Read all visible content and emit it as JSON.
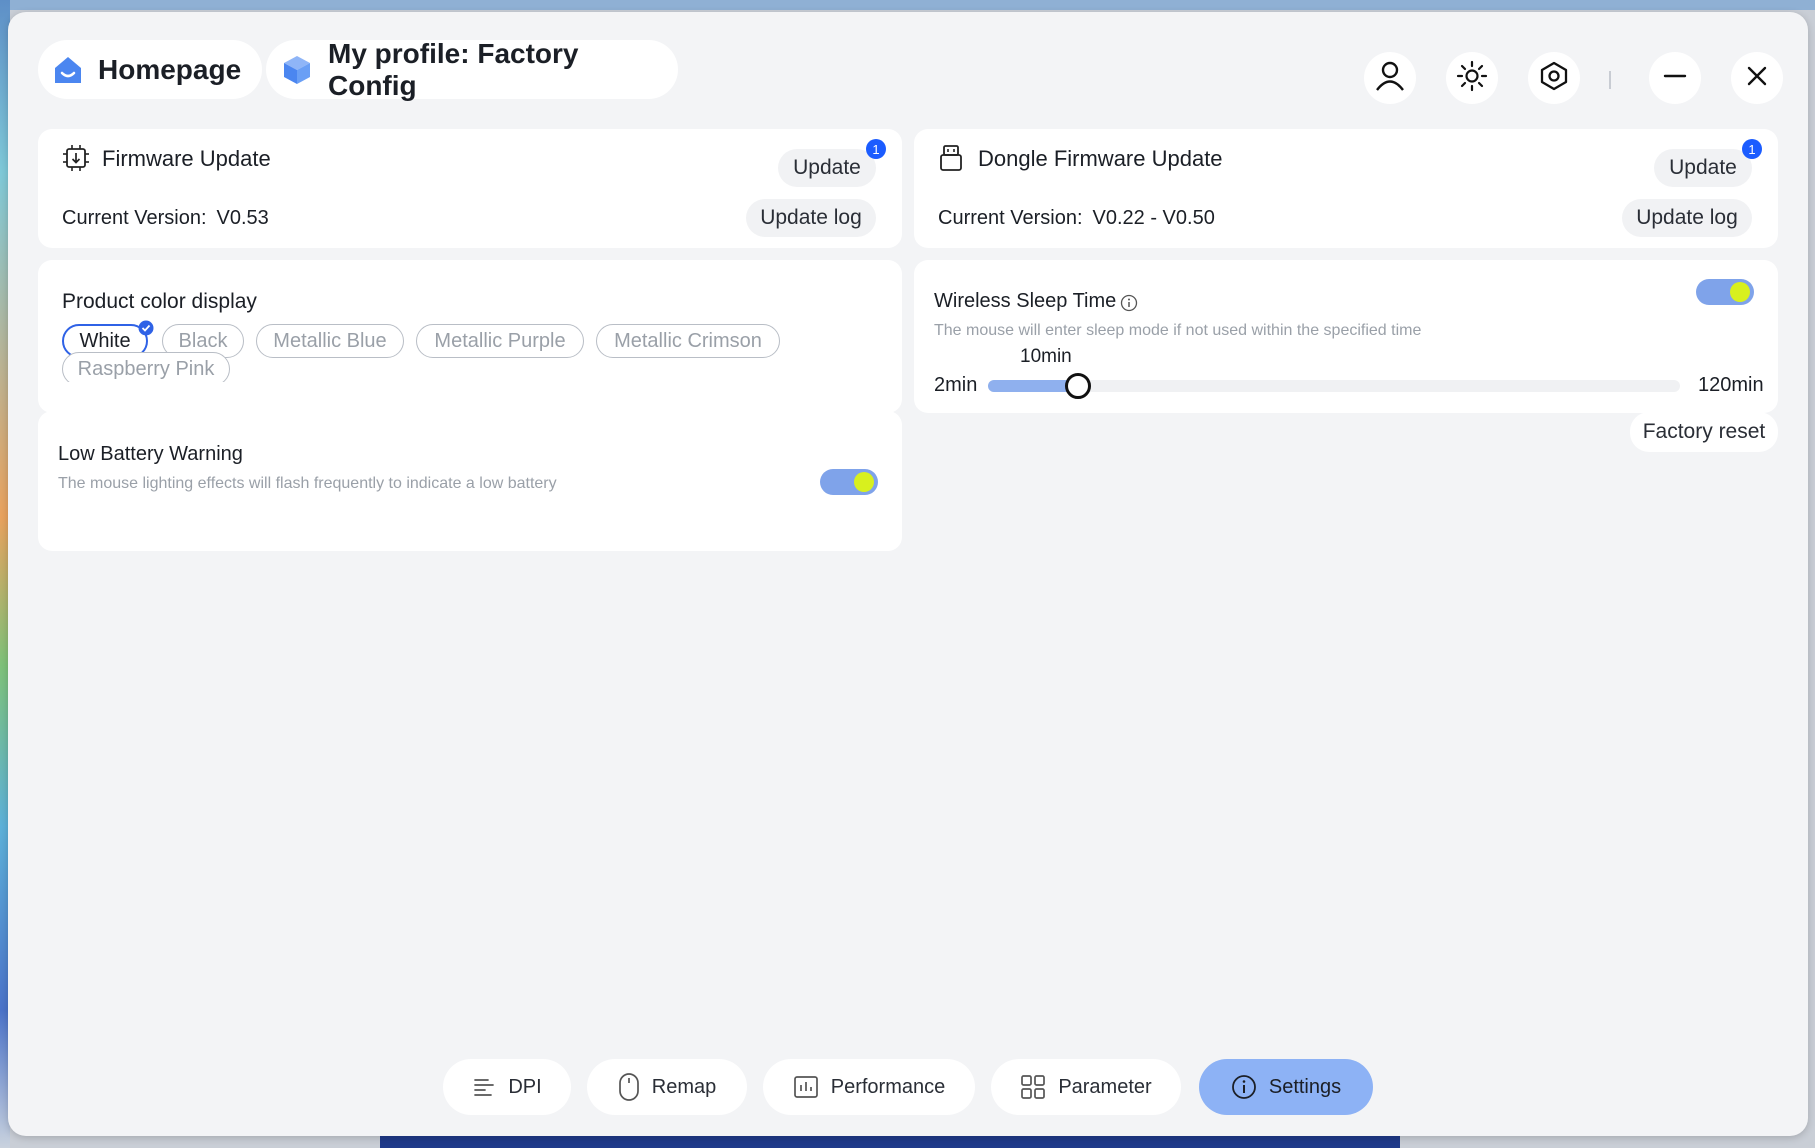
{
  "header": {
    "home_tab": "Homepage",
    "profile_tab": "My profile: Factory Config",
    "icons": [
      "user-icon",
      "brightness-icon",
      "hexagon-settings-icon",
      "minimize-icon",
      "close-icon"
    ]
  },
  "firmware": {
    "title": "Firmware Update",
    "update_label": "Update",
    "badge": "1",
    "version_label": "Current Version:",
    "version_value": "V0.53",
    "log_label": "Update log"
  },
  "dongle": {
    "title": "Dongle Firmware Update",
    "update_label": "Update",
    "badge": "1",
    "version_label": "Current Version:",
    "version_value": "V0.22 - V0.50",
    "log_label": "Update log"
  },
  "color_display": {
    "title": "Product color display",
    "options": [
      "White",
      "Black",
      "Metallic Blue",
      "Metallic Purple",
      "Metallic Crimson",
      "Raspberry Pink"
    ],
    "selected": "White"
  },
  "sleep": {
    "title": "Wireless Sleep Time",
    "description": "The mouse will enter sleep mode if not used within the specified time",
    "enabled": true,
    "min_label": "2min",
    "max_label": "120min",
    "value_label": "10min",
    "min": 2,
    "max": 120,
    "value": 10
  },
  "battery": {
    "title": "Low Battery Warning",
    "description": "The mouse lighting effects will flash frequently to indicate a low battery",
    "enabled": true
  },
  "factory_reset_label": "Factory reset",
  "bottom_nav": [
    {
      "label": "DPI",
      "icon": "dpi-icon"
    },
    {
      "label": "Remap",
      "icon": "mouse-icon"
    },
    {
      "label": "Performance",
      "icon": "performance-icon"
    },
    {
      "label": "Parameter",
      "icon": "grid-icon"
    },
    {
      "label": "Settings",
      "icon": "info-icon"
    }
  ],
  "colors": {
    "accent": "#2f62e6",
    "toggle_track": "#7fa3ea",
    "toggle_knob": "#d8f01e",
    "active_nav": "#8db2f5",
    "badge": "#1b5cff"
  }
}
